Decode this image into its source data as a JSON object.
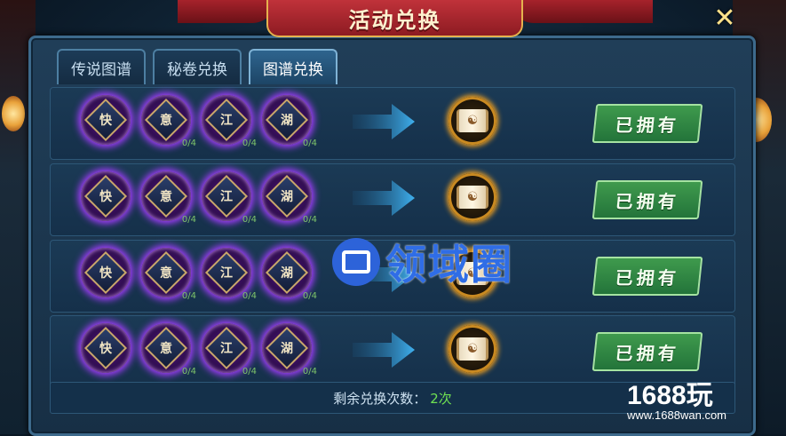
{
  "title": "活动兑换",
  "close_icon": "close-icon",
  "tabs": [
    {
      "label": "传说图谱",
      "active": false
    },
    {
      "label": "秘卷兑换",
      "active": false
    },
    {
      "label": "图谱兑换",
      "active": true
    }
  ],
  "rows": [
    {
      "materials": [
        {
          "char": "快",
          "count": ""
        },
        {
          "char": "意",
          "count": "0/4"
        },
        {
          "char": "江",
          "count": "0/4"
        },
        {
          "char": "湖",
          "count": "0/4"
        }
      ],
      "button": "已拥有"
    },
    {
      "materials": [
        {
          "char": "快",
          "count": ""
        },
        {
          "char": "意",
          "count": "0/4"
        },
        {
          "char": "江",
          "count": "0/4"
        },
        {
          "char": "湖",
          "count": "0/4"
        }
      ],
      "button": "已拥有"
    },
    {
      "materials": [
        {
          "char": "快",
          "count": ""
        },
        {
          "char": "意",
          "count": "0/4"
        },
        {
          "char": "江",
          "count": "0/4"
        },
        {
          "char": "湖",
          "count": "0/4"
        }
      ],
      "button": "已拥有"
    },
    {
      "materials": [
        {
          "char": "快",
          "count": ""
        },
        {
          "char": "意",
          "count": "0/4"
        },
        {
          "char": "江",
          "count": "0/4"
        },
        {
          "char": "湖",
          "count": "0/4"
        }
      ],
      "button": "已拥有"
    }
  ],
  "footer": {
    "label": "剩余兑换次数：",
    "value": "2次"
  },
  "watermark": "领域圈",
  "brand": {
    "name": "1688玩",
    "url": "www.1688wan.com"
  },
  "colors": {
    "accent": "#6fe052",
    "banner": "#c0323a",
    "glow": "#a43dff"
  }
}
